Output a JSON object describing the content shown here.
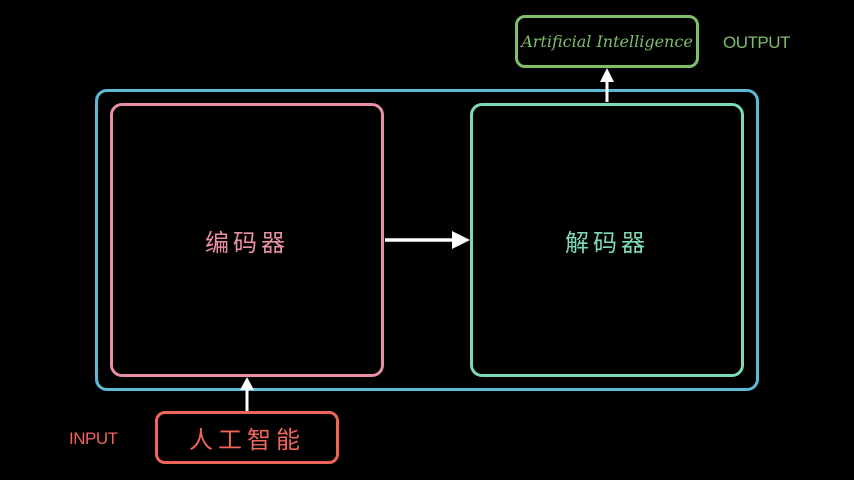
{
  "colors": {
    "background": "#000000",
    "container": "#5bbad5",
    "encoder": "#e98fa3",
    "decoder": "#7ed9b5",
    "output": "#7fbf6a",
    "input": "#f0645a",
    "arrow": "#ffffff"
  },
  "encoder": {
    "label": "编码器"
  },
  "decoder": {
    "label": "解码器"
  },
  "output": {
    "text": "Artificial Intelligence",
    "tag": "OUTPUT"
  },
  "input": {
    "text": "人工智能",
    "tag": "INPUT"
  }
}
